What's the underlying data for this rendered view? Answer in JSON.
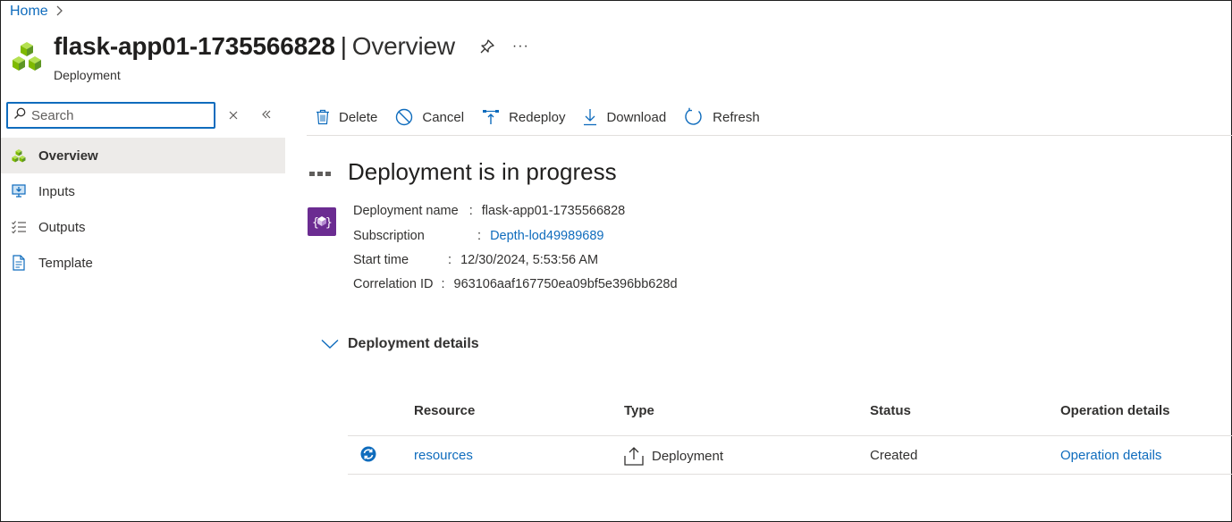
{
  "breadcrumb": {
    "home": "Home"
  },
  "header": {
    "resource_name": "flask-app01-1735566828",
    "separator": "|",
    "page": "Overview",
    "more": "···",
    "subtitle": "Deployment"
  },
  "search": {
    "placeholder": "Search",
    "value": ""
  },
  "sidebar": {
    "items": [
      {
        "label": "Overview",
        "icon": "cubes-icon",
        "active": true
      },
      {
        "label": "Inputs",
        "icon": "inputs-icon"
      },
      {
        "label": "Outputs",
        "icon": "outputs-icon"
      },
      {
        "label": "Template",
        "icon": "template-icon"
      }
    ]
  },
  "toolbar": {
    "delete": "Delete",
    "cancel": "Cancel",
    "redeploy": "Redeploy",
    "download": "Download",
    "refresh": "Refresh"
  },
  "status": {
    "title": "Deployment is in progress"
  },
  "info": {
    "name_label": "Deployment name",
    "name_value": "flask-app01-1735566828",
    "subscription_label": "Subscription",
    "subscription_value": "Depth-lod49989689",
    "start_label": "Start time",
    "start_value": "12/30/2024, 5:53:56 AM",
    "corr_label": "Correlation ID",
    "corr_value": "963106aaf167750ea09bf5e396bb628d",
    "colon": ":"
  },
  "details": {
    "title": "Deployment details",
    "columns": [
      "Resource",
      "Type",
      "Status",
      "Operation details"
    ],
    "rows": [
      {
        "resource": "resources",
        "type": "Deployment",
        "status": "Created",
        "operation": "Operation details"
      }
    ]
  },
  "colors": {
    "accent": "#0f6cbd",
    "deploy_icon_bg": "#6b2c91",
    "cube_green": "#7fba00",
    "active_bg": "#edebe9"
  }
}
